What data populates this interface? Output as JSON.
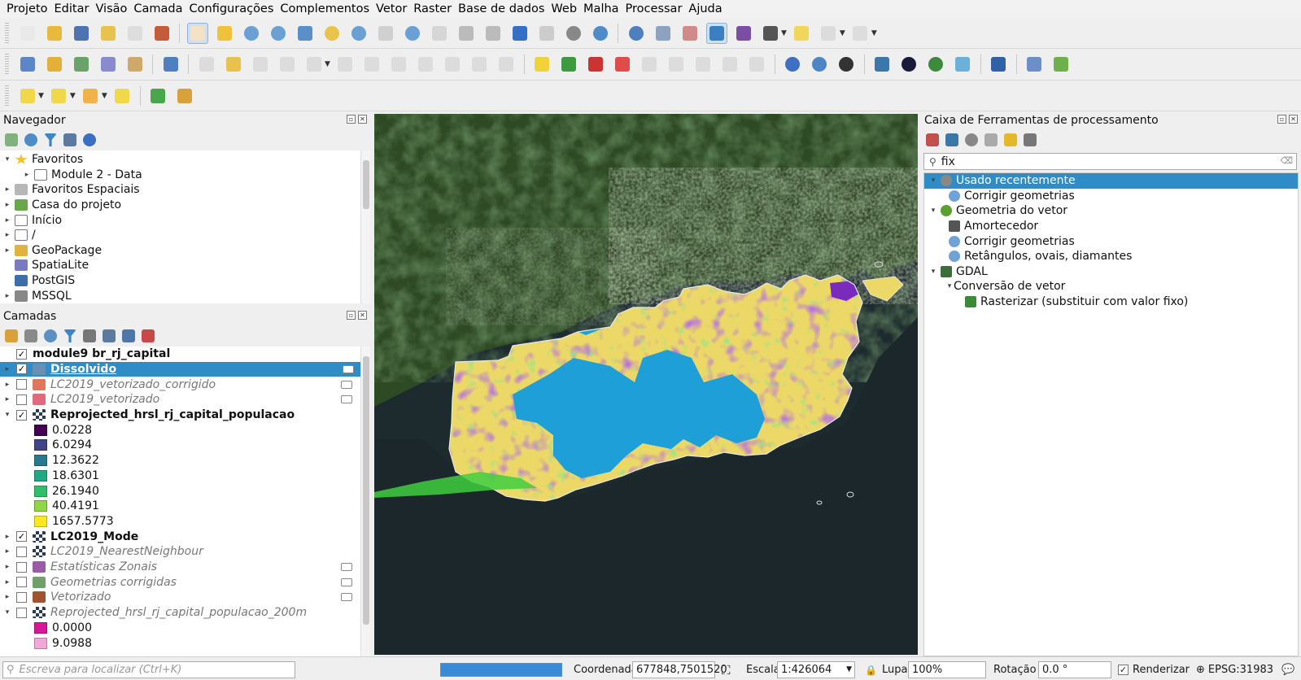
{
  "menu": [
    "Projeto",
    "Editar",
    "Visão",
    "Camada",
    "Configurações",
    "Complementos",
    "Vetor",
    "Raster",
    "Base de dados",
    "Web",
    "Malha",
    "Processar",
    "Ajuda"
  ],
  "navigator": {
    "title": "Navegador",
    "items": [
      {
        "label": "Favoritos",
        "icon": "star-icon",
        "expanded": true
      },
      {
        "label": "Module 2 - Data",
        "icon": "folder-icon",
        "child": true
      },
      {
        "label": "Favoritos Espaciais",
        "icon": "spatial-bookmark-icon"
      },
      {
        "label": "Casa do projeto",
        "icon": "project-home-icon"
      },
      {
        "label": "Início",
        "icon": "home-folder-icon"
      },
      {
        "label": "/",
        "icon": "folder-icon"
      },
      {
        "label": "GeoPackage",
        "icon": "geopackage-icon"
      },
      {
        "label": "SpatiaLite",
        "icon": "spatialite-icon"
      },
      {
        "label": "PostGIS",
        "icon": "postgis-icon"
      },
      {
        "label": "MSSQL",
        "icon": "mssql-icon"
      }
    ]
  },
  "layers": {
    "title": "Camadas",
    "items": [
      {
        "label": "module9 br_rj_capital",
        "checked": true,
        "bold": true,
        "kind": "group"
      },
      {
        "label": "Dissolvido",
        "checked": true,
        "selected": true,
        "kind": "vector",
        "swatch": "#6a8fb5"
      },
      {
        "label": "LC2019_vetorizado_corrigido",
        "checked": false,
        "italic": true,
        "kind": "vector",
        "swatch": "#e0775a"
      },
      {
        "label": "LC2019_vetorizado",
        "checked": false,
        "italic": true,
        "kind": "vector",
        "swatch": "#e0697e"
      },
      {
        "label": "Reprojected_hrsl_rj_capital_populacao",
        "checked": true,
        "bold": true,
        "kind": "raster",
        "expanded": true
      },
      {
        "label": "0.0228",
        "legend": true,
        "swatch": "#440154"
      },
      {
        "label": "6.0294",
        "legend": true,
        "swatch": "#414487"
      },
      {
        "label": "12.3622",
        "legend": true,
        "swatch": "#2a788e"
      },
      {
        "label": "18.6301",
        "legend": true,
        "swatch": "#22a884"
      },
      {
        "label": "26.1940",
        "legend": true,
        "swatch": "#2fbf68"
      },
      {
        "label": "40.4191",
        "legend": true,
        "swatch": "#8fd744"
      },
      {
        "label": "1657.5773",
        "legend": true,
        "swatch": "#fde725"
      },
      {
        "label": "LC2019_Mode",
        "checked": true,
        "bold": true,
        "kind": "raster"
      },
      {
        "label": "LC2019_NearestNeighbour",
        "checked": false,
        "italic": true,
        "kind": "raster"
      },
      {
        "label": "Estatísticas Zonais",
        "checked": false,
        "italic": true,
        "kind": "vector",
        "swatch": "#9a5aa6"
      },
      {
        "label": "Geometrias corrigidas",
        "checked": false,
        "italic": true,
        "kind": "vector",
        "swatch": "#6fa06a"
      },
      {
        "label": "Vetorizado",
        "checked": false,
        "italic": true,
        "kind": "vector",
        "swatch": "#a0532e"
      },
      {
        "label": "Reprojected_hrsl_rj_capital_populacao_200m",
        "checked": false,
        "italic": true,
        "kind": "raster",
        "expanded": true
      },
      {
        "label": "0.0000",
        "legend": true,
        "swatch": "#d6179a"
      },
      {
        "label": "9.0988",
        "legend": true,
        "swatch": "#f0a8d8"
      }
    ]
  },
  "toolbox": {
    "title": "Caixa de Ferramentas de processamento",
    "search_value": "fix",
    "items": [
      {
        "label": "Usado recentemente",
        "level": 0,
        "icon": "clock-icon",
        "selected": true
      },
      {
        "label": "Corrigir geometrias",
        "level": 1,
        "icon": "gear-icon"
      },
      {
        "label": "Geometria do vetor",
        "level": 0,
        "icon": "qgis-icon"
      },
      {
        "label": "Amortecedor",
        "level": 1,
        "icon": "buffer-icon"
      },
      {
        "label": "Corrigir geometrias",
        "level": 1,
        "icon": "gear-icon"
      },
      {
        "label": "Retângulos, ovais, diamantes",
        "level": 1,
        "icon": "gear-icon"
      },
      {
        "label": "GDAL",
        "level": 0,
        "icon": "gdal-icon"
      },
      {
        "label": "Conversão de vetor",
        "level": 1,
        "icon": "none"
      },
      {
        "label": "Rasterizar (substituir com valor fixo)",
        "level": 2,
        "icon": "rasterize-icon"
      }
    ]
  },
  "statusbar": {
    "locator_placeholder": "Escreva para localizar (Ctrl+K)",
    "progress": 1.0,
    "coord_label": "Coordenada",
    "coord_value": "677848,7501520",
    "scale_label": "Escala",
    "scale_value": "1:426064",
    "zoom_label": "Lupa",
    "zoom_value": "100%",
    "rotation_label": "Rotação",
    "rotation_value": "0.0 °",
    "render_label": "Renderizar",
    "render_checked": true,
    "crs": "EPSG:31983"
  },
  "colors": {
    "selection": "#308cc6",
    "pop_yellow": "#ecd867",
    "pop_blue": "#1f9fd8",
    "pop_purple": "#7a2bbd",
    "pop_green": "#3fcf3f",
    "sea": "#1d2a2e"
  }
}
